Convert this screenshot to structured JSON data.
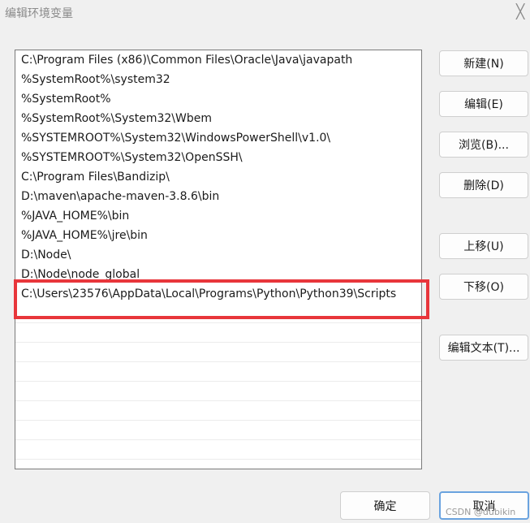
{
  "window": {
    "title": "编辑环境变量",
    "close_glyph": "╳"
  },
  "paths": [
    "C:\\Program Files (x86)\\Common Files\\Oracle\\Java\\javapath",
    "%SystemRoot%\\system32",
    "%SystemRoot%",
    "%SystemRoot%\\System32\\Wbem",
    "%SYSTEMROOT%\\System32\\WindowsPowerShell\\v1.0\\",
    "%SYSTEMROOT%\\System32\\OpenSSH\\",
    "C:\\Program Files\\Bandizip\\",
    "D:\\maven\\apache-maven-3.8.6\\bin",
    "%JAVA_HOME%\\bin",
    "%JAVA_HOME%\\jre\\bin",
    "D:\\Node\\",
    "D:\\Node\\node_global",
    "C:\\Users\\23576\\AppData\\Local\\Programs\\Python\\Python39\\Scripts"
  ],
  "buttons": {
    "new": "新建(N)",
    "edit": "编辑(E)",
    "browse": "浏览(B)...",
    "delete": "删除(D)",
    "move_up": "上移(U)",
    "move_down": "下移(O)",
    "edit_text": "编辑文本(T)...",
    "ok": "确定",
    "cancel": "取消"
  },
  "watermark": "CSDN @dubikin",
  "colors": {
    "highlight_border": "#e8363b",
    "focus_border": "#6aa3df"
  }
}
